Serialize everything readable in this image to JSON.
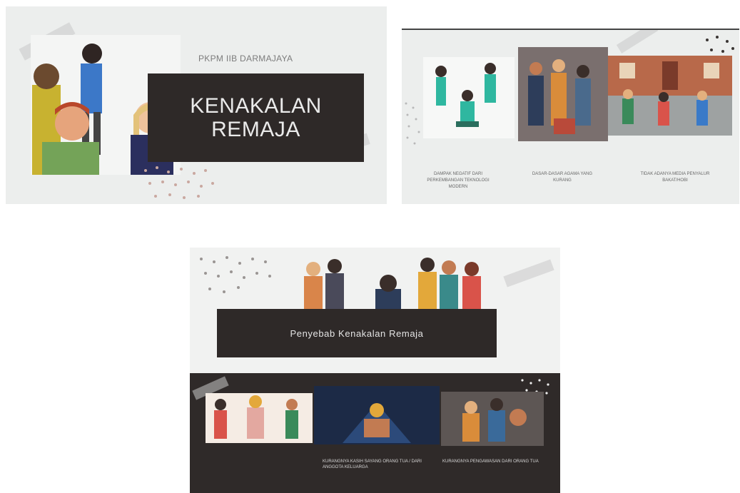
{
  "slides": [
    {
      "subtitle": "PKPM IIB DARMAJAYA",
      "title": "KENAKALAN\nREMAJA"
    },
    {
      "captions": [
        "DAMPAK NEGATIF DARI PERKEMBANGAN TEKNOLOGI MODERN",
        "DASAR-DASAR AGAMA YANG KURANG",
        "TIDAK ADANYA MEDIA PENYALUR BAKAT/HOBI"
      ]
    },
    {
      "title": "Penyebab Kenakalan  Remaja",
      "captions": [
        "",
        "KURANGNYA KASIH SAYANG ORANG TUA / DARI ANGGOTA KELUARGA",
        "KURANGNYA PENGAWASAN DARI ORANG TUA"
      ]
    }
  ],
  "colors": {
    "dark_box": "#2e2928",
    "slide_bg": "#eceeed",
    "accent_skin": "#c27b52"
  }
}
